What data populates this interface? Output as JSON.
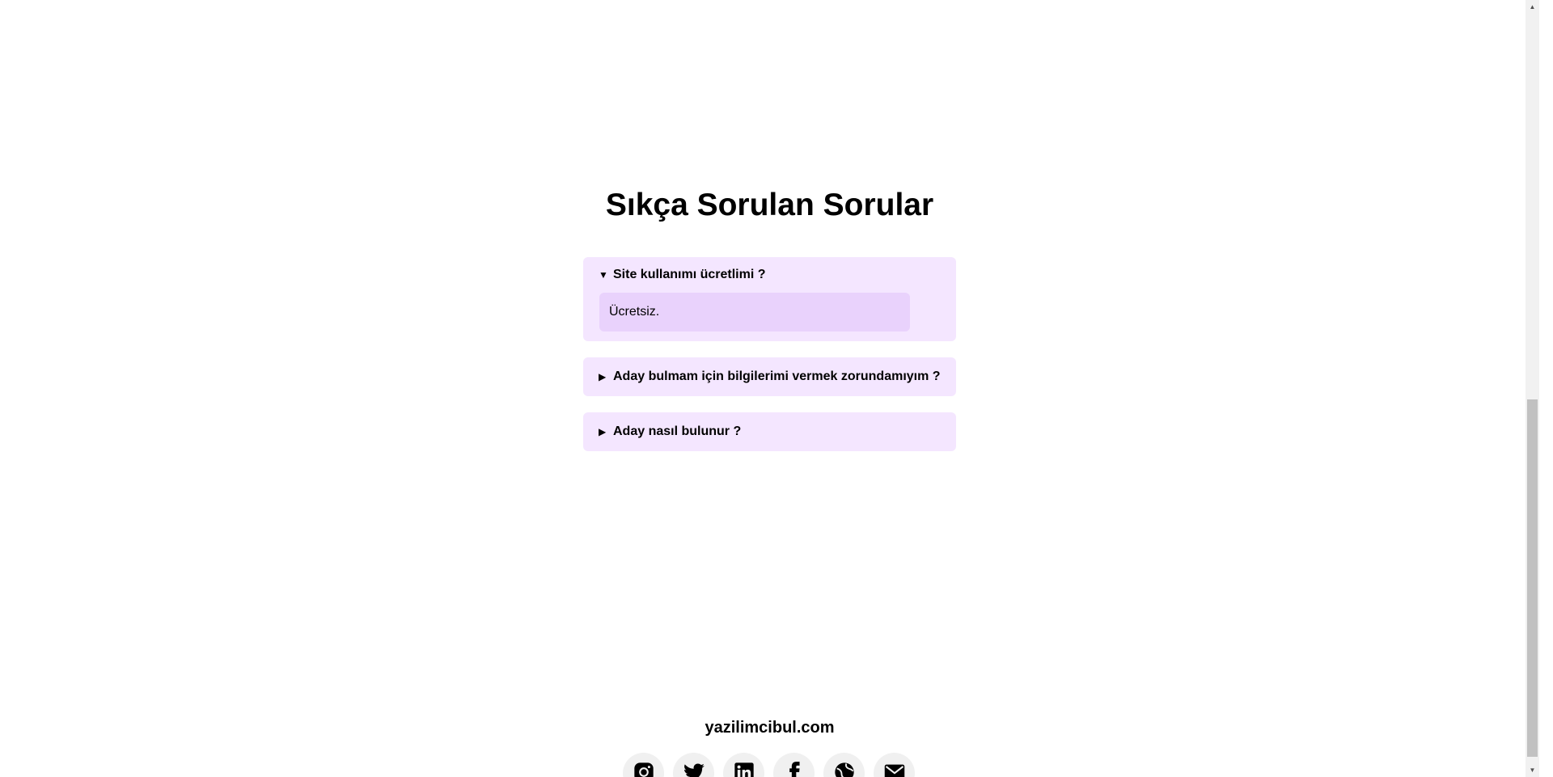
{
  "faq": {
    "title": "Sıkça Sorulan Sorular",
    "items": [
      {
        "question": "Site kullanımı ücretlimi ?",
        "answer": "Ücretsiz.",
        "open": true
      },
      {
        "question": "Aday bulmam için bilgilerimi vermek zorundamıyım ?",
        "open": false
      },
      {
        "question": "Aday nasıl bulunur ?",
        "open": false
      }
    ],
    "arrow_open": "▼",
    "arrow_closed": "▶"
  },
  "footer": {
    "brand": "yazilimcibul.com",
    "social_icons": [
      "instagram-icon",
      "twitter-icon",
      "linkedin-icon",
      "facebook-icon",
      "globe-icon",
      "mail-icon"
    ]
  },
  "scrollbar": {
    "up": "▲",
    "down": "▼"
  }
}
